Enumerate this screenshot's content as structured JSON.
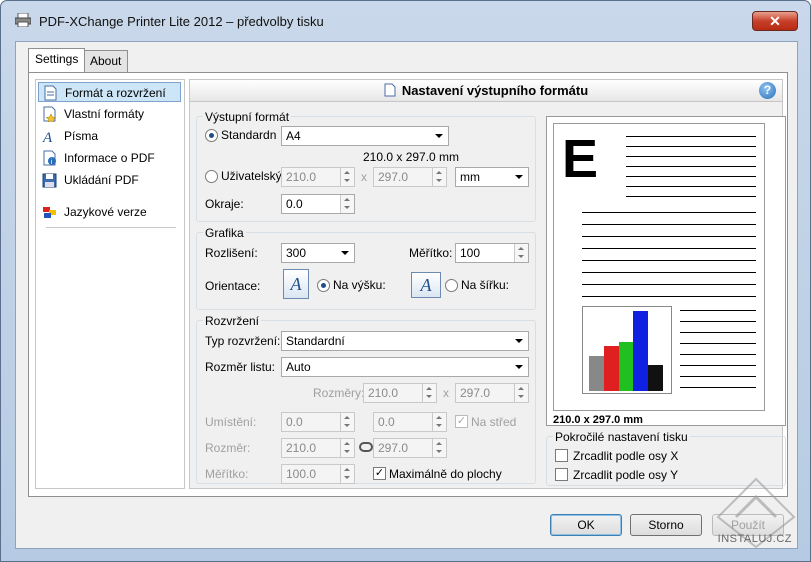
{
  "window": {
    "title": "PDF-XChange Printer Lite 2012 – předvolby tisku",
    "close_label": "✕"
  },
  "tabs": [
    {
      "label": "Settings"
    },
    {
      "label": "About"
    }
  ],
  "nav": {
    "items": [
      {
        "label": "Formát a rozvržení",
        "icon": "page-icon"
      },
      {
        "label": "Vlastní formáty",
        "icon": "star-page-icon"
      },
      {
        "label": "Písma",
        "icon": "font-icon"
      },
      {
        "label": "Informace o PDF",
        "icon": "info-icon"
      },
      {
        "label": "Ukládání PDF",
        "icon": "save-icon"
      },
      {
        "label": "Jazykové verze",
        "icon": "flags-icon"
      }
    ]
  },
  "header": {
    "title": "Nastavení výstupního formátu",
    "help": "?"
  },
  "output_format": {
    "group_label": "Výstupní formát",
    "standard_label": "Standardn",
    "standard_value": "A4",
    "standard_size": "210.0 x 297.0 mm",
    "custom_label": "Uživatelský",
    "custom_width": "210.0",
    "custom_x": "x",
    "custom_height": "297.0",
    "unit": "mm",
    "margins_label": "Okraje:",
    "margins_value": "0.0"
  },
  "graphics": {
    "group_label": "Grafika",
    "resolution_label": "Rozlišení:",
    "resolution_value": "300",
    "scale_label": "Měřítko:",
    "scale_value": "100",
    "orientation_label": "Orientace:",
    "portrait_label": "Na výšku:",
    "landscape_label": "Na šířku:",
    "icon_letter": "A"
  },
  "layout": {
    "group_label": "Rozvržení",
    "type_label": "Typ rozvržení:",
    "type_value": "Standardní",
    "sheet_label": "Rozměr listu:",
    "sheet_value": "Auto",
    "dims_label": "Rozměry:",
    "dims_w": "210.0",
    "dims_x": "x",
    "dims_h": "297.0",
    "placement_label": "Umístění:",
    "placement_x": "0.0",
    "placement_y": "0.0",
    "center_label": "Na střed",
    "size_label": "Rozměr:",
    "size_w": "210.0",
    "size_h": "297.0",
    "scale_label": "Měřítko:",
    "scale_value": "100.0",
    "maximize_label": "Maximálně do plochy"
  },
  "preview": {
    "size_text": "210.0 x 297.0 mm"
  },
  "advanced": {
    "group_label": "Pokročilé nastavení tisku",
    "mirror_x": "Zrcadlit podle osy X",
    "mirror_y": "Zrcadlit podle osy Y"
  },
  "buttons": {
    "ok": "OK",
    "cancel": "Storno",
    "apply": "Použít"
  },
  "watermark": "INSTALUJ.CZ"
}
